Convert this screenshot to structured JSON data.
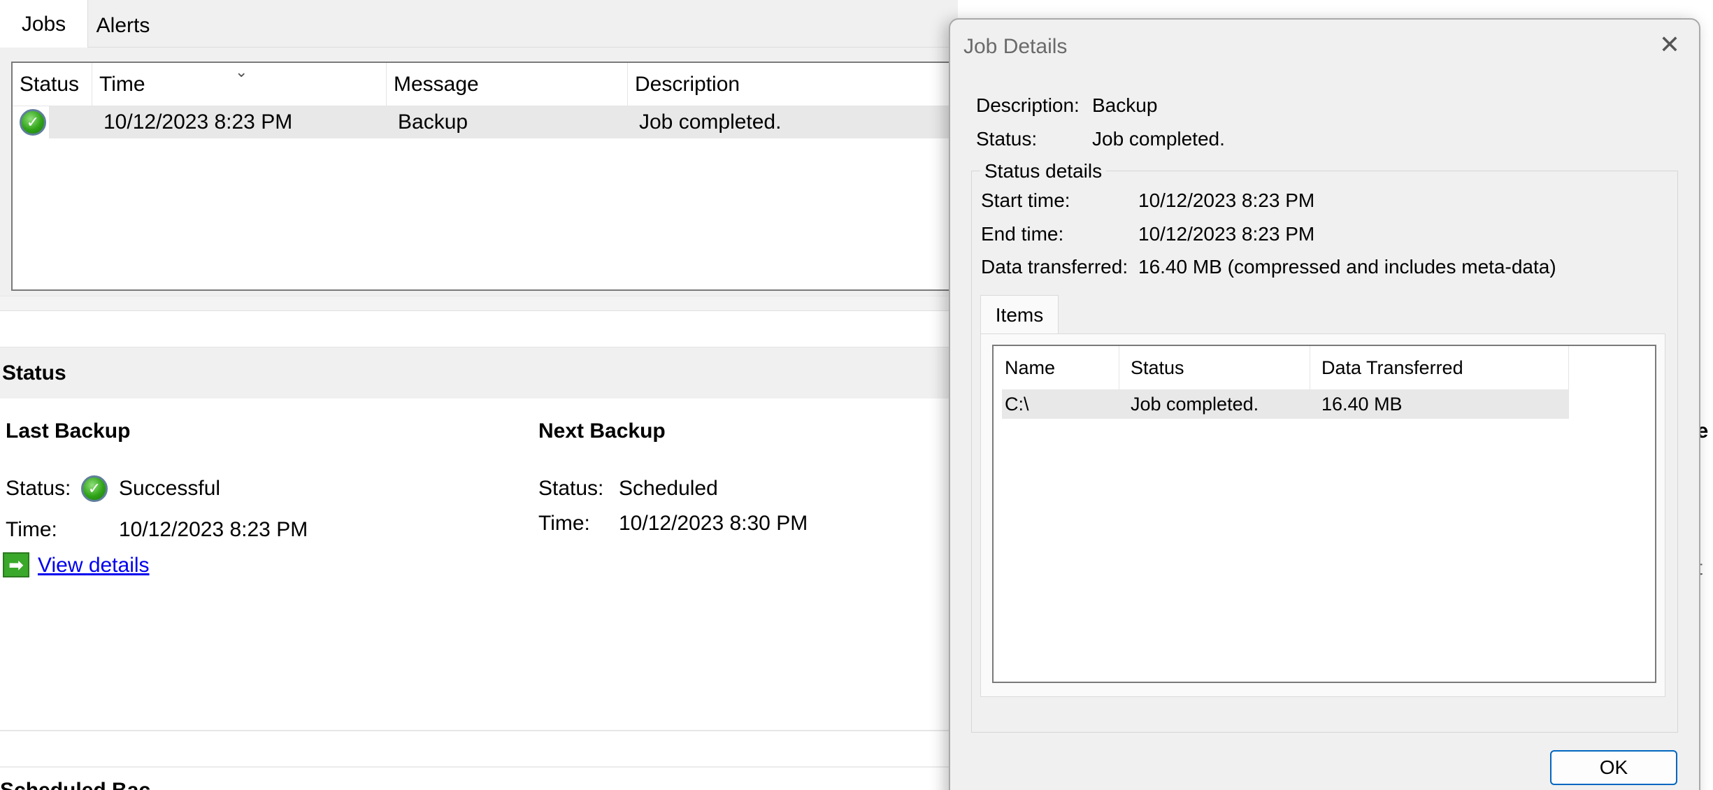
{
  "tabs": [
    {
      "label": "Jobs",
      "active": true
    },
    {
      "label": "Alerts",
      "active": false
    }
  ],
  "jobs_table": {
    "columns": [
      "Status",
      "Time",
      "Message",
      "Description"
    ],
    "rows": [
      {
        "status_icon": "check-circle-icon",
        "time": "10/12/2023 8:23 PM",
        "message": "Backup",
        "description": "Job completed."
      }
    ]
  },
  "status_section": {
    "title": "Status",
    "last_backup": {
      "heading": "Last Backup",
      "status_label": "Status:",
      "status_value": "Successful",
      "time_label": "Time:",
      "time_value": "10/12/2023 8:23 PM",
      "link": "View details"
    },
    "next_backup": {
      "heading": "Next Backup",
      "status_label": "Status:",
      "status_value": "Scheduled",
      "time_label": "Time:",
      "time_value": "10/12/2023 8:30 PM"
    },
    "cut_off_right": [
      "ve",
      "et"
    ],
    "cut_off_bottom": "Scheduled Bac"
  },
  "dialog": {
    "title": "Job Details",
    "description_label": "Description:",
    "description_value": "Backup",
    "status_label": "Status:",
    "status_value": "Job completed.",
    "group_title": "Status details",
    "start_label": "Start time:",
    "start_value": "10/12/2023 8:23 PM",
    "end_label": "End time:",
    "end_value": "10/12/2023 8:23 PM",
    "data_label": "Data transferred:",
    "data_value": "16.40 MB (compressed and includes meta-data)",
    "items_tab": "Items",
    "items_columns": [
      "Name",
      "Status",
      "Data Transferred"
    ],
    "items_rows": [
      {
        "name": "C:\\",
        "status": "Job completed.",
        "data": "16.40 MB"
      }
    ],
    "ok_label": "OK",
    "close_glyph": "✕"
  },
  "colors": {
    "accent": "#0067c0",
    "link": "#0000ee",
    "success_green": "#2fa317",
    "selected_row": "#e8e8e8",
    "dialog_bg": "#f0f0f0"
  }
}
